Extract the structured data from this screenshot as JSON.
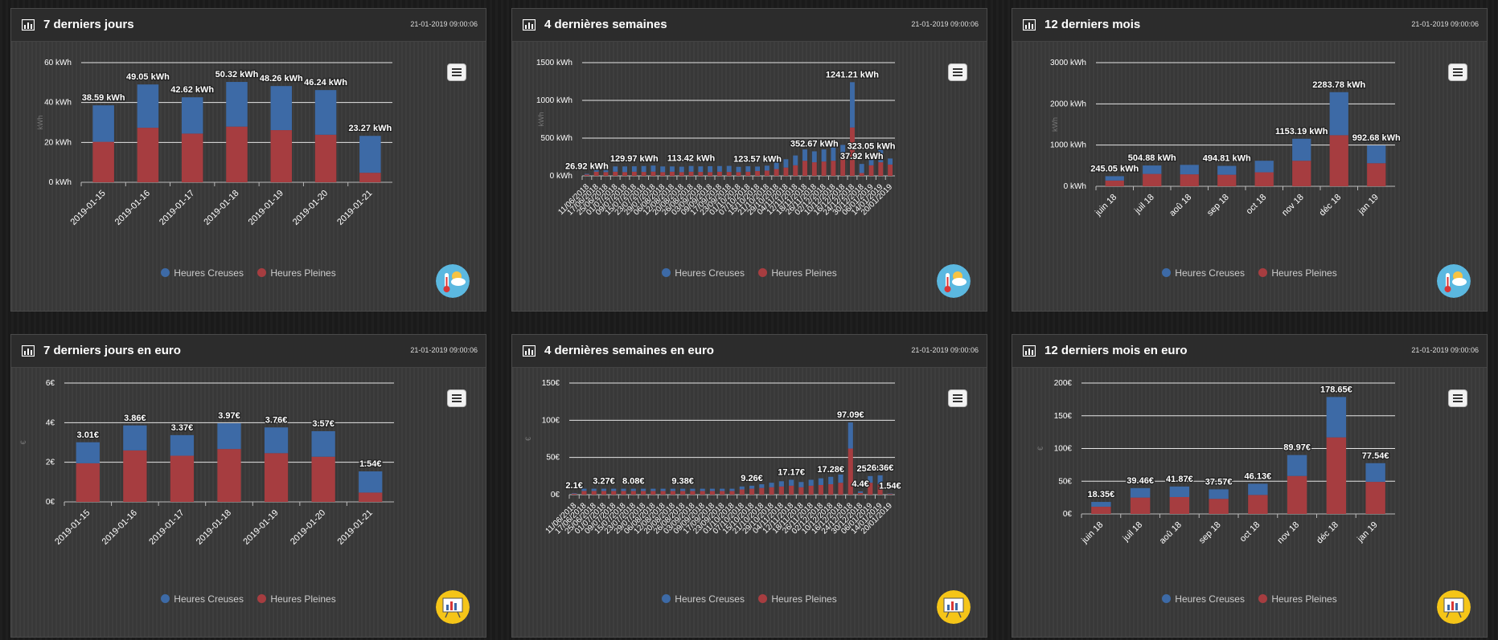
{
  "colors": {
    "hc": "#3d6aa6",
    "hp": "#a63d40"
  },
  "legend": {
    "hc": "Heures Creuses",
    "hp": "Heures Pleines"
  },
  "panels": [
    {
      "title": "7 derniers jours",
      "date": "21-01-2019 09:00:06",
      "badge_icon": "weather-thermometer-icon",
      "chart_data": {
        "type": "bar",
        "stacked": true,
        "categories": [
          "2019-01-15",
          "2019-01-16",
          "2019-01-17",
          "2019-01-18",
          "2019-01-19",
          "2019-01-20",
          "2019-01-21"
        ],
        "series": [
          {
            "name": "Heures Creuses",
            "values": [
              18.3,
              21.7,
              18.2,
              22.4,
              22.1,
              22.4,
              18.5
            ]
          },
          {
            "name": "Heures Pleines",
            "values": [
              20.29,
              27.35,
              24.42,
              27.92,
              26.16,
              23.84,
              4.77
            ]
          }
        ],
        "totals": [
          "38.59 kWh",
          "49.05 kWh",
          "42.62 kWh",
          "50.32 kWh",
          "48.26 kWh",
          "46.24 kWh",
          "23.27 kWh"
        ],
        "yticks": [
          "0 kWh",
          "20 kWh",
          "40 kWh",
          "60 kWh"
        ],
        "ylim": [
          0,
          60
        ],
        "ylabel": "kWh",
        "grid": true
      }
    },
    {
      "title": "4 dernières semaines",
      "date": "21-01-2019 09:00:06",
      "badge_icon": "weather-thermometer-icon",
      "chart_data": {
        "type": "bar",
        "stacked": true,
        "categories": [
          "11/06/2018",
          "17/06/2018",
          "25/06/2018",
          "01/07/2018",
          "09/07/2018",
          "15/07/2018",
          "23/07/2018",
          "29/07/2018",
          "06/08/2018",
          "12/08/2018",
          "20/08/2018",
          "26/08/2018",
          "03/09/2018",
          "09/09/2018",
          "17/09/2018",
          "23/09/2018",
          "01/10/2018",
          "07/10/2018",
          "15/10/2018",
          "21/10/2018",
          "29/10/2018",
          "04/11/2018",
          "12/11/2018",
          "18/11/2018",
          "26/11/2018",
          "02/12/2018",
          "10/12/2018",
          "16/12/2018",
          "24/12/2018",
          "30/12/2018",
          "06/01/2019",
          "14/01/2019",
          "20/01/2019"
        ],
        "series": [
          {
            "name": "Heures Creuses",
            "values": [
              10,
              80,
              75,
              70,
              75,
              72,
              78,
              80,
              75,
              70,
              72,
              76,
              74,
              78,
              75,
              80,
              70,
              72,
              60,
              65,
              95,
              110,
              130,
              150,
              145,
              160,
              175,
              190,
              600,
              120,
              150,
              200,
              80
            ]
          },
          {
            "name": "Heures Pleines",
            "values": [
              16.92,
              55,
              50,
              55,
              50,
              55,
              52,
              56,
              50,
              55,
              50,
              55,
              52,
              50,
              55,
              52,
              50,
              55,
              63.57,
              70,
              90,
              110,
              140,
              200,
              180,
              190,
              200,
              220,
              641.21,
              37.92,
              140,
              180,
              150
            ]
          }
        ],
        "total_labels": [
          {
            "index": 0,
            "text": "26.92 kWh"
          },
          {
            "index": 5,
            "text": "129.97 kWh"
          },
          {
            "index": 11,
            "text": "113.42 kWh"
          },
          {
            "index": 18,
            "text": "123.57 kWh"
          },
          {
            "index": 24,
            "text": "352.67 kWh"
          },
          {
            "index": 28,
            "text": "1241.21 kWh"
          },
          {
            "index": 30,
            "text": "323.05 kWh"
          },
          {
            "index": 29,
            "text": "37.92 kWh"
          }
        ],
        "yticks": [
          "0 kWh",
          "500 kWh",
          "1000 kWh",
          "1500 kWh"
        ],
        "ylim": [
          0,
          1500
        ],
        "ylabel": "kWh",
        "grid": true
      }
    },
    {
      "title": "12 derniers mois",
      "date": "21-01-2019 09:00:06",
      "badge_icon": "weather-thermometer-icon",
      "chart_data": {
        "type": "bar",
        "stacked": true,
        "categories": [
          "juin 18",
          "juil 18",
          "aoû 18",
          "sep 18",
          "oct 18",
          "nov 18",
          "déc 18",
          "jan 19"
        ],
        "series": [
          {
            "name": "Heures Creuses",
            "values": [
              105.05,
              204.88,
              230,
              214.81,
              280,
              533.19,
              1043.78,
              432.68
            ]
          },
          {
            "name": "Heures Pleines",
            "values": [
              140,
              300,
              290,
              280,
              340,
              620,
              1240,
              560
            ]
          }
        ],
        "totals": [
          "245.05 kWh",
          "504.88 kWh",
          "",
          "494.81 kWh",
          "",
          "1153.19 kWh",
          "2283.78 kWh",
          "992.68 kWh"
        ],
        "yticks": [
          "0 kWh",
          "1000 kWh",
          "2000 kWh",
          "3000 kWh"
        ],
        "ylim": [
          0,
          3000
        ],
        "ylabel": "kWh",
        "grid": true
      }
    },
    {
      "title": "7 derniers jours en euro",
      "date": "21-01-2019 09:00:06",
      "badge_icon": "presentation-board-icon",
      "chart_data": {
        "type": "bar",
        "stacked": true,
        "categories": [
          "2019-01-15",
          "2019-01-16",
          "2019-01-17",
          "2019-01-18",
          "2019-01-19",
          "2019-01-20",
          "2019-01-21"
        ],
        "series": [
          {
            "name": "Heures Creuses",
            "values": [
              1.06,
              1.26,
              1.04,
              1.3,
              1.3,
              1.29,
              1.07
            ]
          },
          {
            "name": "Heures Pleines",
            "values": [
              1.95,
              2.6,
              2.33,
              2.67,
              2.46,
              2.28,
              0.47
            ]
          }
        ],
        "totals": [
          "3.01€",
          "3.86€",
          "3.37€",
          "3.97€",
          "3.76€",
          "3.57€",
          "1.54€"
        ],
        "yticks": [
          "0€",
          "2€",
          "4€",
          "6€"
        ],
        "ylim": [
          0,
          6
        ],
        "ylabel": "€",
        "grid": true
      }
    },
    {
      "title": "4 dernières semaines en euro",
      "date": "21-01-2019 09:00:06",
      "badge_icon": "presentation-board-icon",
      "chart_data": {
        "type": "bar",
        "stacked": true,
        "categories": [
          "11/06/2018",
          "17/06/2018",
          "25/06/2018",
          "01/07/2018",
          "09/07/2018",
          "15/07/2018",
          "23/07/2018",
          "29/07/2018",
          "06/08/2018",
          "12/08/2018",
          "20/08/2018",
          "26/08/2018",
          "03/09/2018",
          "09/09/2018",
          "17/09/2018",
          "23/09/2018",
          "01/10/2018",
          "07/10/2018",
          "15/10/2018",
          "21/10/2018",
          "29/10/2018",
          "04/11/2018",
          "12/11/2018",
          "18/11/2018",
          "26/11/2018",
          "02/12/2018",
          "10/12/2018",
          "16/12/2018",
          "24/12/2018",
          "30/12/2018",
          "06/01/2019",
          "14/01/2019",
          "20/01/2019"
        ],
        "series": [
          {
            "name": "Heures Creuses",
            "values": [
              0.8,
              3,
              3,
              3,
              3,
              3,
              3,
              3,
              3,
              3,
              3,
              3,
              3,
              3,
              3,
              3,
              3,
              4,
              4,
              5,
              6,
              7,
              8,
              7,
              8,
              9,
              10,
              11,
              35,
              2,
              9,
              12,
              0.6
            ]
          },
          {
            "name": "Heures Pleines",
            "values": [
              1.3,
              5,
              5,
              5,
              5,
              5,
              5,
              5,
              5,
              5,
              5,
              5,
              5,
              5,
              5,
              5,
              5,
              7,
              8,
              9,
              10,
              11,
              12,
              10,
              12,
              13,
              14,
              16,
              62,
              2.4,
              16,
              14,
              0.94
            ]
          }
        ],
        "total_labels": [
          {
            "index": 0,
            "text": "2.1€"
          },
          {
            "index": 3,
            "text": "3.27€"
          },
          {
            "index": 6,
            "text": "8.08€"
          },
          {
            "index": 11,
            "text": "9.38€"
          },
          {
            "index": 18,
            "text": "9.26€"
          },
          {
            "index": 22,
            "text": "17.17€"
          },
          {
            "index": 26,
            "text": "17.28€"
          },
          {
            "index": 28,
            "text": "97.09€"
          },
          {
            "index": 29,
            "text": "4.4€"
          },
          {
            "index": 30,
            "text": "25.48€"
          },
          {
            "index": 31,
            "text": "26.36€"
          },
          {
            "index": 32,
            "text": "1.54€"
          }
        ],
        "yticks": [
          "0€",
          "50€",
          "100€",
          "150€"
        ],
        "ylim": [
          0,
          150
        ],
        "ylabel": "€",
        "grid": true
      }
    },
    {
      "title": "12 derniers mois en euro",
      "date": "21-01-2019 09:00:06",
      "badge_icon": "presentation-board-icon",
      "chart_data": {
        "type": "bar",
        "stacked": true,
        "categories": [
          "juin 18",
          "juil 18",
          "aoû 18",
          "sep 18",
          "oct 18",
          "nov 18",
          "déc 18",
          "jan 19"
        ],
        "series": [
          {
            "name": "Heures Creuses",
            "values": [
              7.35,
              14.46,
              16.07,
              14.57,
              17.13,
              31.97,
              61.65,
              28.54
            ]
          },
          {
            "name": "Heures Pleines",
            "values": [
              11,
              25,
              25.8,
              23,
              29,
              58,
              117,
              49
            ]
          }
        ],
        "totals": [
          "18.35€",
          "39.46€",
          "41.87€",
          "37.57€",
          "46.13€",
          "89.97€",
          "178.65€",
          "77.54€"
        ],
        "yticks": [
          "0€",
          "50€",
          "100€",
          "150€",
          "200€"
        ],
        "ylim": [
          0,
          200
        ],
        "ylabel": "€",
        "grid": true
      }
    }
  ]
}
